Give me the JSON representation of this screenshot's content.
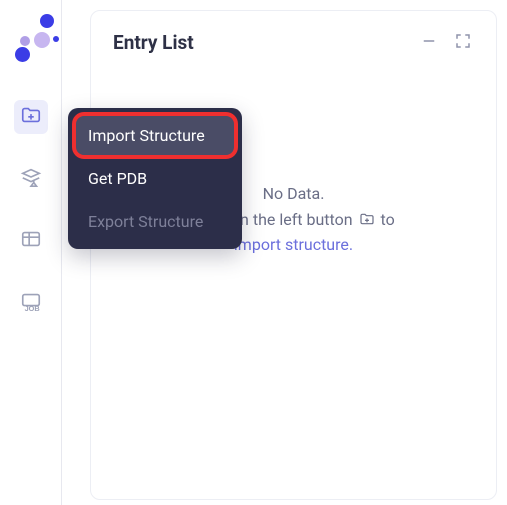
{
  "panel": {
    "title": "Entry List",
    "empty_line1": "No Data.",
    "empty_prefix": "Click on the left button",
    "empty_suffix": "to",
    "empty_link": "import structure."
  },
  "menu": {
    "items": [
      {
        "label": "Import Structure"
      },
      {
        "label": "Get PDB"
      },
      {
        "label": "Export Structure"
      }
    ]
  }
}
